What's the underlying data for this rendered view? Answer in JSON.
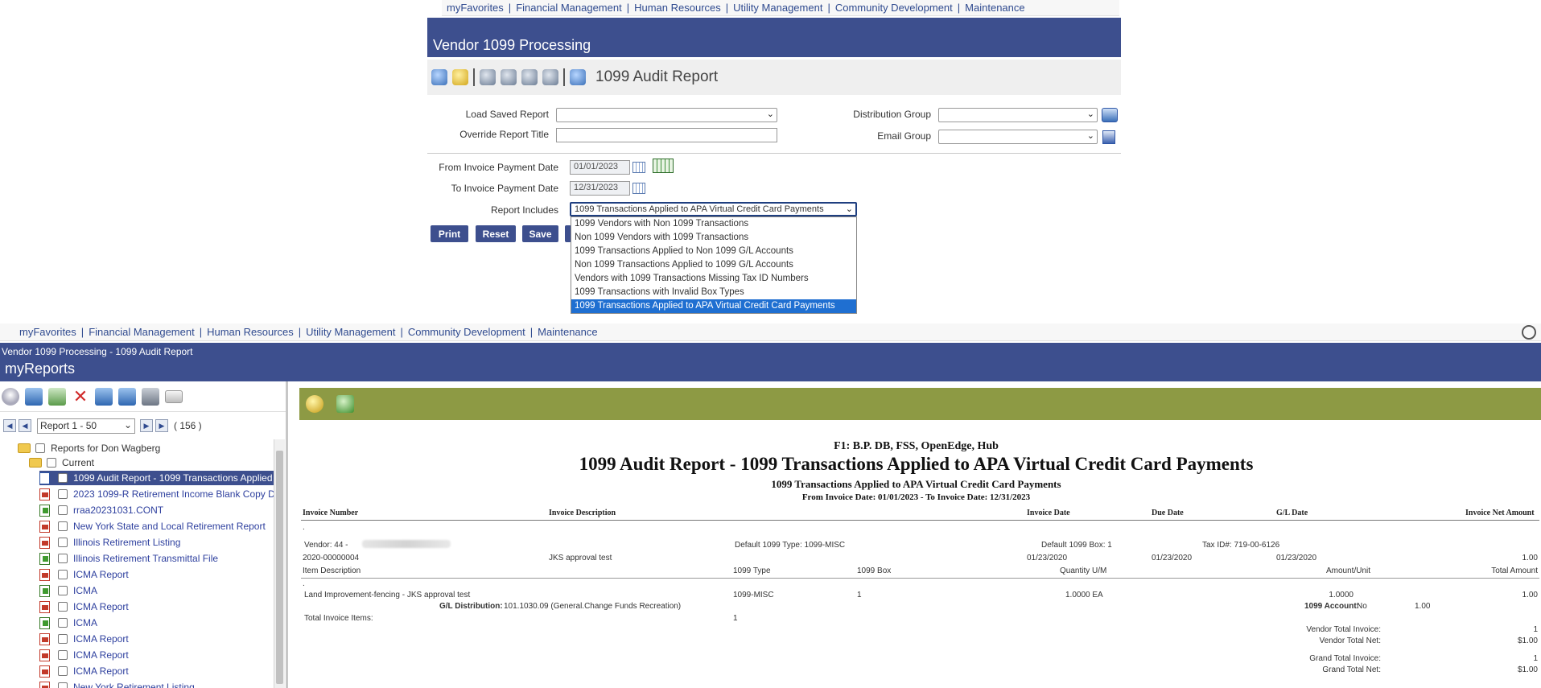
{
  "top_screen": {
    "nav": [
      "myFavorites",
      "Financial Management",
      "Human Resources",
      "Utility Management",
      "Community Development",
      "Maintenance"
    ],
    "banner_title": "Vendor 1099 Processing",
    "report_title": "1099 Audit Report",
    "form": {
      "load_saved_report_label": "Load Saved Report",
      "override_title_label": "Override Report Title",
      "distribution_group_label": "Distribution Group",
      "email_group_label": "Email Group",
      "from_date_label": "From Invoice Payment Date",
      "from_date_value": "01/01/2023",
      "to_date_label": "To Invoice Payment Date",
      "to_date_value": "12/31/2023",
      "report_includes_label": "Report Includes",
      "report_includes_value": "1099 Transactions Applied to APA Virtual Credit Card Payments"
    },
    "buttons": {
      "print": "Print",
      "reset": "Reset",
      "save": "Save"
    },
    "dropdown_options": [
      "1099 Vendors with Non 1099 Transactions",
      "Non 1099 Vendors with 1099 Transactions",
      "1099 Transactions Applied to Non 1099 G/L Accounts",
      "Non 1099 Transactions Applied to 1099 G/L Accounts",
      "Vendors with 1099 Transactions Missing Tax ID Numbers",
      "1099 Transactions with Invalid Box Types",
      "1099 Transactions Applied to APA Virtual Credit Card Payments"
    ],
    "selected_option_index": 6
  },
  "bottom_screen": {
    "nav": [
      "myFavorites",
      "Financial Management",
      "Human Resources",
      "Utility Management",
      "Community Development",
      "Maintenance"
    ],
    "breadcrumb": "Vendor 1099 Processing - 1099 Audit Report",
    "section_title": "myReports",
    "pager": {
      "range": "Report 1 - 50",
      "count": "( 156 )"
    },
    "tree": {
      "root": "Reports for Don Wagberg",
      "folder": "Current",
      "items": [
        {
          "label": "1099 Audit Report - 1099 Transactions Applied",
          "icon": "doc",
          "selected": true
        },
        {
          "label": "2023 1099-R Retirement Income Blank Copy D",
          "icon": "pdf"
        },
        {
          "label": "rraa20231031.CONT",
          "icon": "export"
        },
        {
          "label": "New York State and Local Retirement Report",
          "icon": "pdf"
        },
        {
          "label": "Illinois Retirement Listing",
          "icon": "pdf"
        },
        {
          "label": "Illinois Retirement Transmittal File",
          "icon": "export"
        },
        {
          "label": "ICMA Report",
          "icon": "pdf"
        },
        {
          "label": "ICMA",
          "icon": "export"
        },
        {
          "label": "ICMA Report",
          "icon": "pdf"
        },
        {
          "label": "ICMA",
          "icon": "export"
        },
        {
          "label": "ICMA Report",
          "icon": "pdf"
        },
        {
          "label": "ICMA Report",
          "icon": "pdf"
        },
        {
          "label": "ICMA Report",
          "icon": "pdf"
        },
        {
          "label": "New York Retirement Listing",
          "icon": "pdf"
        }
      ]
    },
    "report": {
      "company": "F1: B.P. DB, FSS, OpenEdge, Hub",
      "title": "1099 Audit Report - 1099 Transactions Applied to APA Virtual Credit Card Payments",
      "subtitle": "1099 Transactions Applied to APA Virtual Credit Card Payments",
      "date_range": "From Invoice Date: 01/01/2023 - To Invoice Date: 12/31/2023",
      "headers": {
        "invoice_number": "Invoice Number",
        "invoice_description": "Invoice Description",
        "invoice_date": "Invoice Date",
        "due_date": "Due Date",
        "gl_date": "G/L Date",
        "invoice_net_amount": "Invoice Net Amount"
      },
      "dot": ".",
      "vendor_label": "Vendor: 44 -",
      "default_1099_type": "Default 1099 Type: 1099-MISC",
      "default_1099_box": "Default 1099 Box: 1",
      "tax_id": "Tax ID#: 719-00-6126",
      "invoice": {
        "number": "2020-00000004",
        "description": "JKS approval test",
        "invoice_date": "01/23/2020",
        "due_date": "01/23/2020",
        "gl_date": "01/23/2020",
        "net_amount": "1.00"
      },
      "item_headers": {
        "item_description": "Item Description",
        "type": "1099 Type",
        "box": "1099 Box",
        "qty": "Quantity U/M",
        "amount_unit": "Amount/Unit",
        "total_amount": "Total Amount"
      },
      "item": {
        "description": "Land Improvement-fencing - JKS approval test",
        "type": "1099-MISC",
        "box": "1",
        "qty": "1.0000 EA",
        "amount_unit": "1.0000",
        "total": "1.00"
      },
      "gl_distribution_label": "G/L Distribution:",
      "gl_distribution_value": "101.1030.09 (General.Change Funds Recreation)",
      "account_label": "1099 Account:",
      "account_value": "No",
      "account_amount": "1.00",
      "total_items_label": "Total Invoice Items:",
      "total_items_value": "1",
      "totals": [
        {
          "label": "Vendor Total Invoice:",
          "value": "1"
        },
        {
          "label": "Vendor Total Net:",
          "value": "$1.00"
        },
        {
          "label": "Grand Total Invoice:",
          "value": "1"
        },
        {
          "label": "Grand Total Net:",
          "value": "$1.00"
        }
      ]
    }
  }
}
